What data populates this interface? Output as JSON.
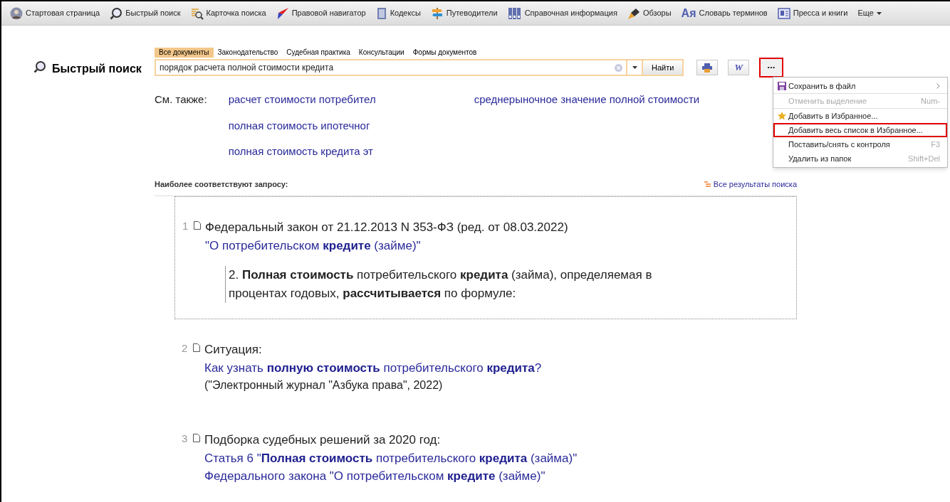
{
  "toolbar": [
    {
      "label": "Стартовая страница",
      "kind": "avatar"
    },
    {
      "label": "Быстрый поиск",
      "kind": "search"
    },
    {
      "label": "Карточка поиска",
      "kind": "card"
    },
    {
      "label": "Правовой навигатор",
      "kind": "navigator"
    },
    {
      "label": "Кодексы",
      "kind": "book"
    },
    {
      "label": "Путеводители",
      "kind": "signpost"
    },
    {
      "label": "Справочная информация",
      "kind": "binders"
    },
    {
      "label": "Обзоры",
      "kind": "pen"
    },
    {
      "label": "Словарь терминов",
      "kind": "dictionary"
    },
    {
      "label": "Пресса и книги",
      "kind": "press"
    },
    {
      "label": "Еще",
      "kind": "more"
    }
  ],
  "dictionary_glyph": "Ая",
  "page_title": "Быстрый поиск",
  "search": {
    "tabs": [
      {
        "label": "Все документы",
        "selected": true
      },
      {
        "label": "Законодательство",
        "selected": false
      },
      {
        "label": "Судебная практика",
        "selected": false
      },
      {
        "label": "Консультации",
        "selected": false
      },
      {
        "label": "Формы документов",
        "selected": false
      }
    ],
    "value": "порядок расчета полной стоимости кредита",
    "button": "Найти"
  },
  "word_glyph": "W",
  "more_button": {
    "label": "•••",
    "highlighted": true
  },
  "see_also": {
    "label": "См. также:",
    "links": [
      [
        "расчет стоимости потребител",
        "среднерыночное значение полной стоимости"
      ],
      [
        "полная стоимость ипотечног"
      ],
      [
        "полная стоимость кредита эт"
      ]
    ]
  },
  "menu": [
    {
      "label": "Сохранить в файл",
      "kind": "save",
      "disabled": false,
      "highlighted": false,
      "submenu": true
    },
    {
      "label": "Отменить выделение",
      "shortcut": "Num-",
      "kind": "plain",
      "disabled": true,
      "highlighted": false,
      "submenu": false
    },
    {
      "label": "Добавить в Избранное...",
      "kind": "star",
      "disabled": false,
      "highlighted": false,
      "submenu": false
    },
    {
      "label": "Добавить весь список в Избранное...",
      "kind": "plain",
      "disabled": false,
      "highlighted": true,
      "submenu": false
    },
    {
      "label": "Поставить/снять с контроля",
      "shortcut": "F3",
      "kind": "plain",
      "disabled": false,
      "highlighted": false,
      "submenu": false
    },
    {
      "label": "Удалить из папок",
      "shortcut": "Shift+Del",
      "kind": "plain",
      "disabled": false,
      "highlighted": false,
      "submenu": false
    }
  ],
  "results_heading": "Наиболее соответствуют запросу:",
  "all_results": "Все результаты поиска",
  "results": [
    {
      "number": "1",
      "source": "Федеральный закон от 21.12.2013 N 353-ФЗ (ред. от 08.03.2022)",
      "title": [
        "\"О потребительском **кредите** (займе)\""
      ],
      "excerpt": "2. **Полная стоимость** потребительского **кредита** (займа), определяемая в процентах годовых, **рассчитывается** по формуле:",
      "selected": true
    },
    {
      "number": "2",
      "source": "Ситуация:",
      "title": [
        "Как узнать **полную стоимость** потребительского **кредита**?"
      ],
      "note": "(\"Электронный журнал \"Азбука права\", 2022)",
      "selected": false
    },
    {
      "number": "3",
      "source": "Подборка судебных решений за 2020 год:",
      "title": [
        "Статья 6 \"**Полная стоимость** потребительского **кредита** (займа)\"",
        "Федерального закона \"О потребительском **кредите** (займе)\""
      ],
      "selected": false
    }
  ]
}
